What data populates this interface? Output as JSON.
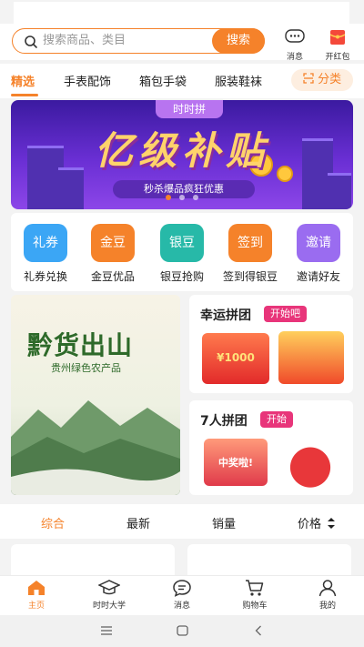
{
  "search": {
    "placeholder": "搜索商品、类目",
    "button": "搜索"
  },
  "top_actions": {
    "message": "消息",
    "red_packet": "开红包"
  },
  "categories": {
    "items": [
      "精选",
      "手表配饰",
      "箱包手袋",
      "服装鞋袜"
    ],
    "classify": "分类"
  },
  "banner": {
    "tag": "时时拼",
    "title": "亿级补贴",
    "subtitle": "秒杀爆品疯狂优惠"
  },
  "quick_links": [
    {
      "icon_text": "礼券",
      "label": "礼券兑换",
      "color": "#3ba6f5",
      "icon": "ticket-icon"
    },
    {
      "icon_text": "金豆",
      "label": "金豆优品",
      "color": "#f5822a",
      "icon": "gold-bean-icon"
    },
    {
      "icon_text": "银豆",
      "label": "银豆抢购",
      "color": "#27b9a8",
      "icon": "silver-bean-icon"
    },
    {
      "icon_text": "签到",
      "label": "签到得银豆",
      "color": "#f5822a",
      "icon": "checkin-icon"
    },
    {
      "icon_text": "邀请",
      "label": "邀请好友",
      "color": "#9a6cf0",
      "icon": "invite-icon"
    }
  ],
  "promo": {
    "title": "黔货出山",
    "subtitle": "贵州绿色农产品"
  },
  "groups": [
    {
      "title": "幸运拼团",
      "badge": "开始吧",
      "image_text": "¥1000"
    },
    {
      "title": "7人拼团",
      "badge": "开始",
      "image_text": "中奖啦!"
    }
  ],
  "sort": {
    "items": [
      "综合",
      "最新",
      "销量",
      "价格"
    ]
  },
  "tabbar": {
    "items": [
      "主页",
      "时时大学",
      "消息",
      "购物车",
      "我的"
    ]
  },
  "colors": {
    "accent": "#f5822a",
    "badge": "#e8357a",
    "banner": "#6a2fd4"
  }
}
